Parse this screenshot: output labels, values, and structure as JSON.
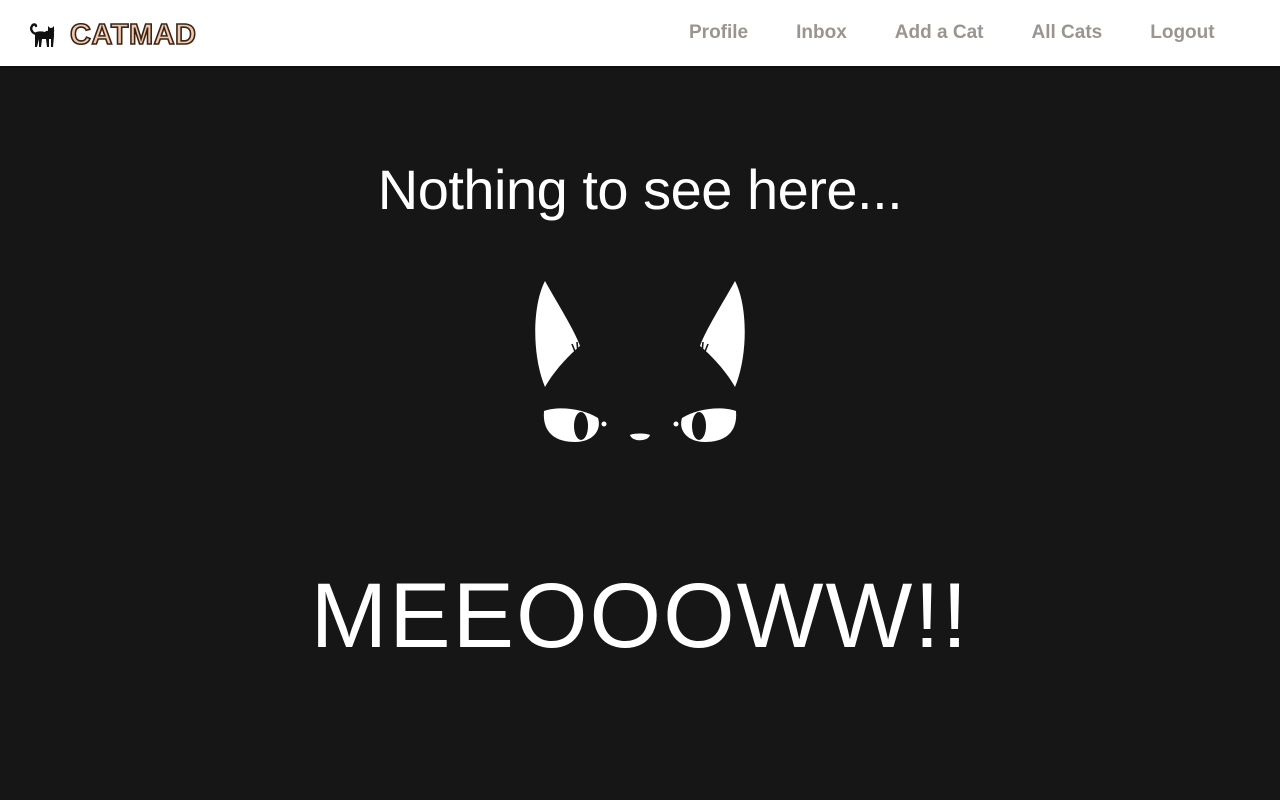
{
  "navbar": {
    "brand": {
      "icon": "black-cat-icon",
      "name": "CATMAD"
    },
    "links": [
      {
        "label": "Profile"
      },
      {
        "label": "Inbox"
      },
      {
        "label": "Add a Cat"
      },
      {
        "label": "All Cats"
      },
      {
        "label": "Logout"
      }
    ]
  },
  "main": {
    "headline": "Nothing to see here...",
    "illustration": "angry-cat-face-icon",
    "meow": "MEEOOOWW!!"
  },
  "colors": {
    "navbar_bg": "#ffffff",
    "nav_link": "#9a958f",
    "page_bg": "#161616",
    "text": "#ffffff",
    "brand_fill": "#f2c9ad",
    "brand_outline": "#3a2418"
  }
}
